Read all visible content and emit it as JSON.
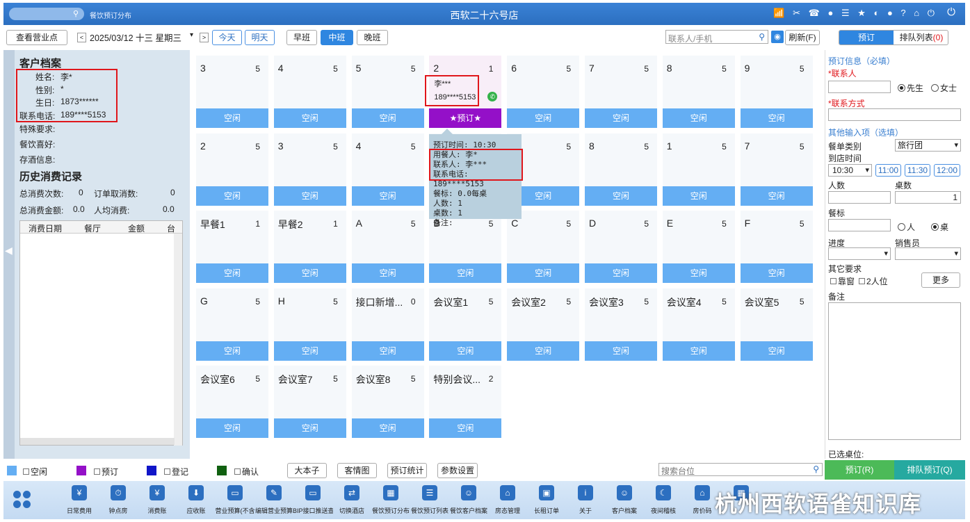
{
  "titlebar": {
    "subtitle": "餐饮预订分布",
    "title": "西软二十六号店",
    "icons": "📶 ✂ ☎ ● ☰ ★ ◐ ● ? ⌂ ⏻"
  },
  "toolbar": {
    "view_btn": "查看营业点",
    "prev": "<",
    "next": ">",
    "date": "2025/03/12 十三 星期三",
    "today": "今天",
    "tomorrow": "明天",
    "shifts": [
      "早班",
      "中班",
      "晚班"
    ],
    "search_placeholder": "联系人/手机",
    "refresh": "刷新(F)"
  },
  "right_tabs": {
    "booking": "预订",
    "queue": "排队列表",
    "queue_count": "(0)"
  },
  "customer": {
    "title": "客户档案",
    "name_label": "姓名:",
    "name": "李*",
    "gender_label": "性别:",
    "gender": "*",
    "birthday_label": "生日:",
    "birthday": "1873******",
    "phone_label": "联系电话:",
    "phone": "189****5153",
    "special_label": "特殊要求:",
    "pref_label": "餐饮喜好:",
    "wine_label": "存酒信息:"
  },
  "history": {
    "title": "历史消费记录",
    "total_count_label": "总消费次数:",
    "total_count": "0",
    "cancel_label": "订单取消数:",
    "cancel": "0",
    "total_amount_label": "总消费金额:",
    "total_amount": "0.0",
    "avg_label": "人均消费:",
    "avg": "0.0",
    "columns": [
      "消费日期",
      "餐厅",
      "金额",
      "台"
    ]
  },
  "tables": [
    {
      "name": "3",
      "count": "5",
      "status": "空闲"
    },
    {
      "name": "4",
      "count": "5",
      "status": "空闲"
    },
    {
      "name": "5",
      "count": "5",
      "status": "空闲"
    },
    {
      "name": "2",
      "count": "1",
      "status": "★预订★",
      "guest": "李***",
      "phone": "189****5153"
    },
    {
      "name": "6",
      "count": "5",
      "status": "空闲"
    },
    {
      "name": "7",
      "count": "5",
      "status": "空闲"
    },
    {
      "name": "8",
      "count": "5",
      "status": "空闲"
    },
    {
      "name": "9",
      "count": "5",
      "status": "空闲"
    },
    {
      "name": "2",
      "count": "5",
      "status": "空闲"
    },
    {
      "name": "3",
      "count": "5",
      "status": "空闲"
    },
    {
      "name": "4",
      "count": "5",
      "status": "空闲"
    },
    {
      "name": "5",
      "count": "5",
      "status": "空闲"
    },
    {
      "name": "",
      "count": "5",
      "status": "空闲"
    },
    {
      "name": "8",
      "count": "5",
      "status": "空闲"
    },
    {
      "name": "1",
      "count": "5",
      "status": "空闲"
    },
    {
      "name": "7",
      "count": "5",
      "status": "空闲"
    },
    {
      "name": "早餐1",
      "count": "1",
      "status": "空闲"
    },
    {
      "name": "早餐2",
      "count": "1",
      "status": "空闲"
    },
    {
      "name": "A",
      "count": "5",
      "status": "空闲"
    },
    {
      "name": "B",
      "count": "5",
      "status": "空闲"
    },
    {
      "name": "C",
      "count": "5",
      "status": "空闲"
    },
    {
      "name": "D",
      "count": "5",
      "status": "空闲"
    },
    {
      "name": "E",
      "count": "5",
      "status": "空闲"
    },
    {
      "name": "F",
      "count": "5",
      "status": "空闲"
    },
    {
      "name": "G",
      "count": "5",
      "status": "空闲"
    },
    {
      "name": "H",
      "count": "5",
      "status": "空闲"
    },
    {
      "name": "接口新增...",
      "count": "0",
      "status": "空闲"
    },
    {
      "name": "会议室1",
      "count": "5",
      "status": "空闲"
    },
    {
      "name": "会议室2",
      "count": "5",
      "status": "空闲"
    },
    {
      "name": "会议室3",
      "count": "5",
      "status": "空闲"
    },
    {
      "name": "会议室4",
      "count": "5",
      "status": "空闲"
    },
    {
      "name": "会议室5",
      "count": "5",
      "status": "空闲"
    },
    {
      "name": "会议室6",
      "count": "5",
      "status": "空闲"
    },
    {
      "name": "会议室7",
      "count": "5",
      "status": "空闲"
    },
    {
      "name": "会议室8",
      "count": "5",
      "status": "空闲"
    },
    {
      "name": "特别会议...",
      "count": "2",
      "status": "空闲"
    }
  ],
  "tooltip": {
    "time": "预订时间: 10:30",
    "diner": "用餐人: 李*",
    "contact": "联系人: 李***",
    "phone": "联系电话: 189****5153",
    "standard": "餐标: 0.0每桌",
    "people": "人数: 1",
    "tables": "桌数: 1",
    "remark": "备注:"
  },
  "form": {
    "info_title": "预订信息（必填）",
    "contact_label": "*联系人",
    "mr": "先生",
    "ms": "女士",
    "phone_label": "*联系方式",
    "other_title": "其他输入项（选填）",
    "meal_type_label": "餐单类别",
    "meal_type": "旅行团",
    "arrive_label": "到店时间",
    "arrive": "10:30",
    "quick_times": [
      "11:00",
      "11:30",
      "12:00"
    ],
    "people_label": "人数",
    "tables_label": "桌数",
    "tables_value": "1",
    "standard_label": "餐标",
    "per_person": "人",
    "per_table": "桌",
    "progress_label": "进度",
    "sales_label": "销售员",
    "other_label": "其它要求",
    "window": "靠窗",
    "two_seat": "2人位",
    "more": "更多",
    "remark_label": "备注",
    "selected_label": "已选桌位:",
    "book_btn": "预订(R)",
    "queue_btn": "排队预订(Q)"
  },
  "legend": {
    "idle": "空闲",
    "booked": "预订",
    "registered": "登记",
    "confirmed": "确认",
    "colors": {
      "idle": "#64aef3",
      "booked": "#9410c8",
      "registered": "#1015c8",
      "confirmed": "#106010"
    },
    "buttons": [
      "大本子",
      "客情图",
      "预订统计",
      "参数设置"
    ],
    "search_placeholder": "搜索台位"
  },
  "dock": [
    {
      "label": "日常费用",
      "icon": "¥"
    },
    {
      "label": "钟点房",
      "icon": "⏱"
    },
    {
      "label": "消费账",
      "icon": "¥"
    },
    {
      "label": "应收账",
      "icon": "⬇"
    },
    {
      "label": "营业预算(不含",
      "icon": "▭"
    },
    {
      "label": "编辑营业预算",
      "icon": "✎"
    },
    {
      "label": "BIP接口推送查",
      "icon": "▭"
    },
    {
      "label": "切换酒店",
      "icon": "⇄"
    },
    {
      "label": "餐饮预订分布",
      "icon": "▦"
    },
    {
      "label": "餐饮预订列表",
      "icon": "☰"
    },
    {
      "label": "餐饮客户档案",
      "icon": "☺"
    },
    {
      "label": "房态管理",
      "icon": "⌂"
    },
    {
      "label": "长租订单",
      "icon": "▣"
    },
    {
      "label": "关于",
      "icon": "i"
    },
    {
      "label": "客户档案",
      "icon": "☺"
    },
    {
      "label": "夜间稽核",
      "icon": "☾"
    },
    {
      "label": "房价码",
      "icon": "⌂"
    },
    {
      "label": "",
      "icon": "▦"
    }
  ],
  "watermark": "杭州西软语雀知识库"
}
